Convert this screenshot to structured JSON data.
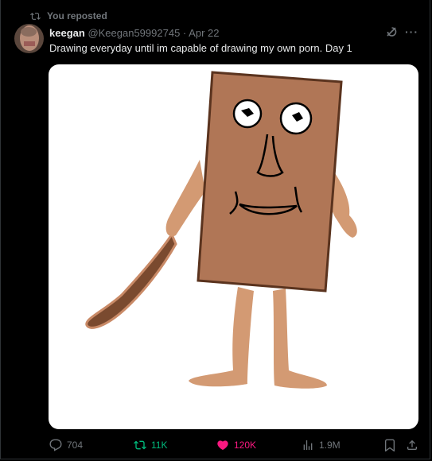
{
  "repost": {
    "label": "You reposted"
  },
  "author": {
    "name": "keegan",
    "handle": "@Keegan59992745",
    "separator": "·",
    "date": "Apr 22"
  },
  "tweet": {
    "text": "Drawing everyday until im capable of drawing my own porn. Day 1"
  },
  "icons": {
    "repost": "repost-icon",
    "grok": "grok-icon",
    "more": "more-icon"
  },
  "metrics": {
    "replies": "704",
    "reposts": "11K",
    "likes": "120K",
    "views": "1.9M"
  },
  "colors": {
    "background": "#000000",
    "text": "#e7e9ea",
    "muted": "#71767b",
    "repost_active": "#00ba7c",
    "like_active": "#f91880",
    "drawing_body": "#b07656",
    "drawing_skin": "#d39a73",
    "drawing_stick": "#7a4a2f"
  }
}
